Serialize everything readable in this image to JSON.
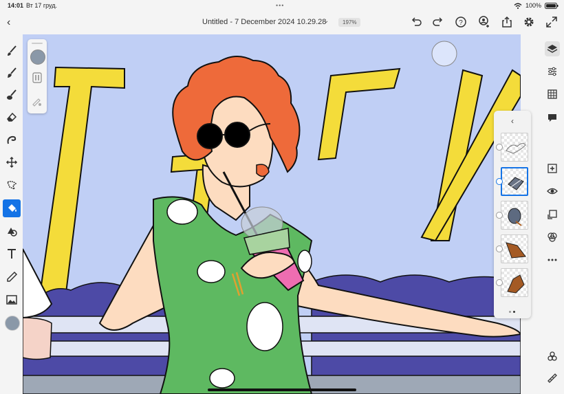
{
  "status_bar": {
    "time": "14:01",
    "date": "Вт 17 груд.",
    "battery": "100%"
  },
  "header": {
    "title": "Untitled - 7 December 2024 10.29.28",
    "zoom": "197%"
  },
  "left_tools": [
    "brush-tool",
    "smudge-tool",
    "blend-tool",
    "eraser-tool",
    "liquify-tool",
    "transform-tool",
    "lasso-tool",
    "fill-tool",
    "shape-tool",
    "text-tool",
    "eyedropper-tool",
    "image-tool"
  ],
  "active_tool": "fill-tool",
  "current_color": "#8a98a8",
  "right_panel": [
    "layers",
    "layer-properties",
    "grid",
    "comments",
    "add-layer",
    "visibility",
    "merge-down",
    "blend-mode",
    "more-options",
    "adjustments",
    "ruler"
  ],
  "layers_panel": {
    "layers": [
      {
        "name": "bird-sketch-layer",
        "selected": false
      },
      {
        "name": "bird-grey-layer",
        "selected": true
      },
      {
        "name": "pigeon-layer",
        "selected": false
      },
      {
        "name": "brown-shape-layer",
        "selected": false
      },
      {
        "name": "brown-shape-layer-2",
        "selected": false
      }
    ]
  },
  "colors": {
    "accent": "#1473e6",
    "sky": "#c0cff5",
    "letters": "#f4dc3a",
    "hair": "#ee6a3a",
    "dress": "#5eb961",
    "skin": "#fddcc0",
    "crowd": "#4d4aa6",
    "cup": "#ee6db1"
  }
}
